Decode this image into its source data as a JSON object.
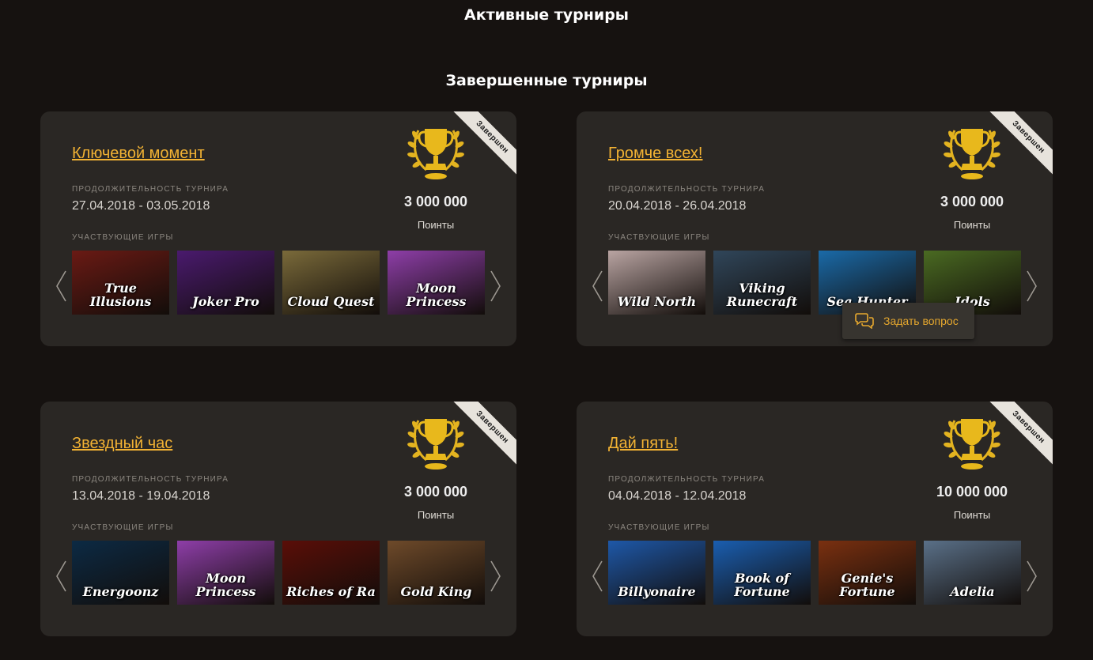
{
  "sections": {
    "active_title": "Активные турниры",
    "finished_title": "Завершенные турниры"
  },
  "colors": {
    "background": "#161210",
    "card": "#2a2724",
    "accent": "#f2b233",
    "ribbon": "#e7e3dc"
  },
  "tournaments": [
    {
      "name": "Ключевой момент",
      "status": "Завершен",
      "duration_label": "ПРОДОЛЖИТЕЛЬНОСТЬ ТУРНИРА",
      "dates": "27.04.2018 - 03.05.2018",
      "prize": "3 000 000",
      "prize_unit": "Поинты",
      "games_label": "УЧАСТВУЮЩИЕ ИГРЫ",
      "games": [
        {
          "title": "True Illusions",
          "color": "#6a1a14"
        },
        {
          "title": "Joker Pro",
          "color": "#4a1a6e"
        },
        {
          "title": "Cloud Quest",
          "color": "#7a6a3a"
        },
        {
          "title": "Moon Princess",
          "color": "#8e3ea8"
        }
      ]
    },
    {
      "name": "Громче всех!",
      "status": "Завершен",
      "duration_label": "ПРОДОЛЖИТЕЛЬНОСТЬ ТУРНИРА",
      "dates": "20.04.2018 - 26.04.2018",
      "prize": "3 000 000",
      "prize_unit": "Поинты",
      "games_label": "УЧАСТВУЮЩИЕ ИГРЫ",
      "games": [
        {
          "title": "Wild North",
          "color": "#b9a4a2"
        },
        {
          "title": "Viking Runecraft",
          "color": "#30465a"
        },
        {
          "title": "Sea Hunter",
          "color": "#1a6aa8"
        },
        {
          "title": "Idols",
          "color": "#4a6a22"
        }
      ]
    },
    {
      "name": "Звездный час",
      "status": "Завершен",
      "duration_label": "ПРОДОЛЖИТЕЛЬНОСТЬ ТУРНИРА",
      "dates": "13.04.2018 - 19.04.2018",
      "prize": "3 000 000",
      "prize_unit": "Поинты",
      "games_label": "УЧАСТВУЮЩИЕ ИГРЫ",
      "games": [
        {
          "title": "Energoonz",
          "color": "#0c2a44"
        },
        {
          "title": "Moon Princess",
          "color": "#8e3ea8"
        },
        {
          "title": "Riches of Ra",
          "color": "#5a0e08"
        },
        {
          "title": "Gold King",
          "color": "#6e4a2a"
        }
      ]
    },
    {
      "name": "Дай пять!",
      "status": "Завершен",
      "duration_label": "ПРОДОЛЖИТЕЛЬНОСТЬ ТУРНИРА",
      "dates": "04.04.2018 - 12.04.2018",
      "prize": "10 000 000",
      "prize_unit": "Поинты",
      "games_label": "УЧАСТВУЮЩИЕ ИГРЫ",
      "games": [
        {
          "title": "Billyonaire",
          "color": "#1e58a8"
        },
        {
          "title": "Book of Fortune",
          "color": "#1a5eb0"
        },
        {
          "title": "Genie's Fortune",
          "color": "#7a3010"
        },
        {
          "title": "Adelia",
          "color": "#5a7088"
        }
      ]
    }
  ],
  "help": {
    "label": "Задать вопрос",
    "icon": "chat-icon"
  }
}
